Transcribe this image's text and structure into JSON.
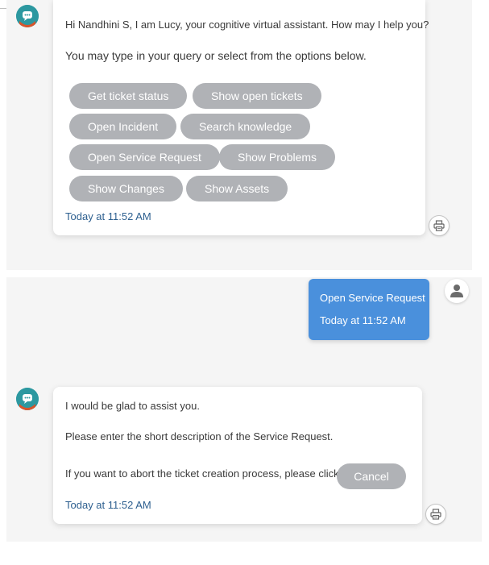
{
  "bot_message_1": {
    "greeting": "Hi Nandhini S, I am Lucy, your cognitive virtual assistant. How may I help you?",
    "instruction": "You may type in your query or select from the options below.",
    "options": [
      "Get ticket status",
      "Show open tickets",
      "Open Incident",
      "Search knowledge",
      "Open Service Request",
      "Show Problems",
      "Show Changes",
      "Show Assets"
    ],
    "timestamp": "Today at 11:52 AM"
  },
  "user_message": {
    "text": "Open Service Request",
    "timestamp": "Today at 11:52 AM"
  },
  "bot_message_2": {
    "line1": "I would be glad to assist you.",
    "line2": "Please enter the short description of the Service Request.",
    "line3": "If you want to abort the ticket creation process, please click",
    "cancel_label": "Cancel",
    "timestamp": "Today at 11:52 AM"
  },
  "colors": {
    "option_button": "#b0b2b6",
    "user_bubble": "#4a90dc",
    "timestamp": "#2d5f8f",
    "bot_avatar": "#2c98a0"
  },
  "icons": {
    "bot_avatar": "bot-avatar-icon",
    "user_avatar": "user-icon",
    "print": "printer-icon"
  }
}
